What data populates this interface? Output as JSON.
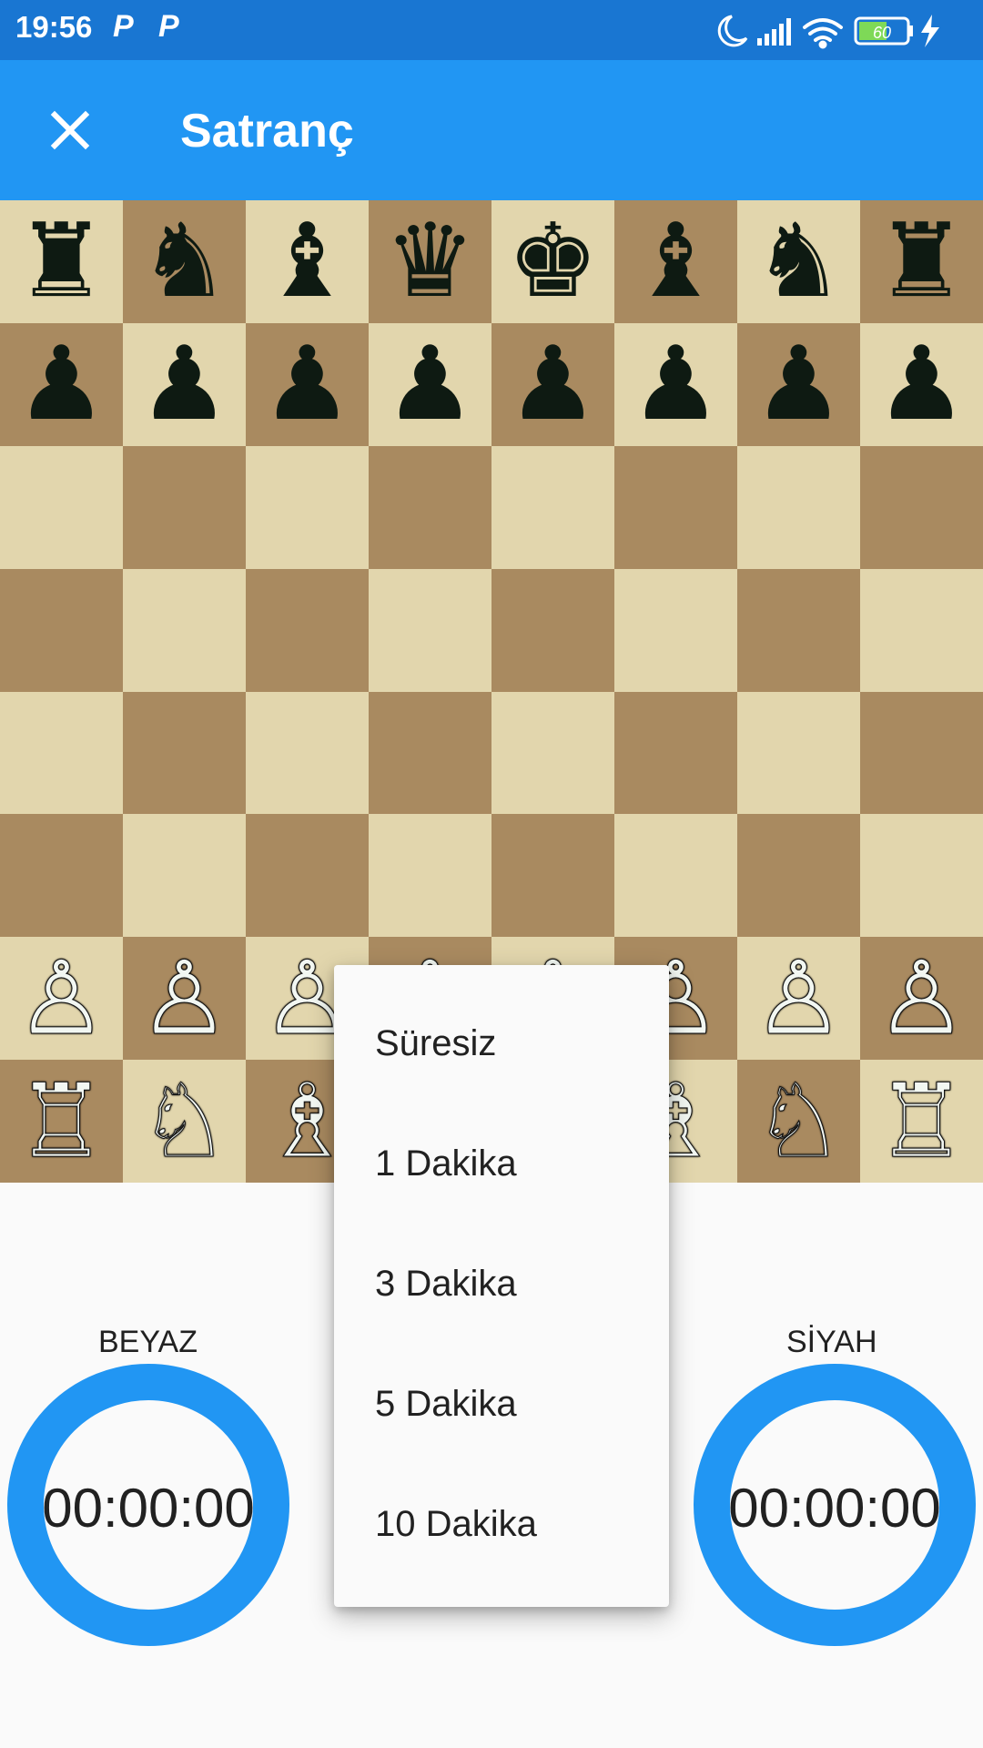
{
  "status_bar": {
    "time": "19:56",
    "notification_icons": [
      "P",
      "P"
    ],
    "battery_level": "60",
    "icons": [
      "moon-icon",
      "signal-icon",
      "wifi-icon",
      "battery-icon",
      "charging-icon"
    ]
  },
  "app_bar": {
    "title": "Satranç",
    "close_icon": "close-icon",
    "color": "#2196f3"
  },
  "board": {
    "light_color": "#e2d6ad",
    "dark_color": "#a98a60",
    "ranks": [
      [
        "♜",
        "♞",
        "♝",
        "♛",
        "♚",
        "♝",
        "♞",
        "♜"
      ],
      [
        "♟",
        "♟",
        "♟",
        "♟",
        "♟",
        "♟",
        "♟",
        "♟"
      ],
      [
        "",
        "",
        "",
        "",
        "",
        "",
        "",
        ""
      ],
      [
        "",
        "",
        "",
        "",
        "",
        "",
        "",
        ""
      ],
      [
        "",
        "",
        "",
        "",
        "",
        "",
        "",
        ""
      ],
      [
        "",
        "",
        "",
        "",
        "",
        "",
        "",
        ""
      ],
      [
        "♙",
        "♙",
        "♙",
        "♙",
        "♙",
        "♙",
        "♙",
        "♙"
      ],
      [
        "♖",
        "♘",
        "♗",
        "♕",
        "♔",
        "♗",
        "♘",
        "♖"
      ]
    ]
  },
  "players": {
    "white": {
      "label": "BEYAZ",
      "time": "00:00:00"
    },
    "black": {
      "label": "SİYAH",
      "time": "00:00:00"
    }
  },
  "time_menu": {
    "options": [
      "Süresiz",
      "1 Dakika",
      "3 Dakika",
      "5 Dakika",
      "10 Dakika"
    ]
  }
}
